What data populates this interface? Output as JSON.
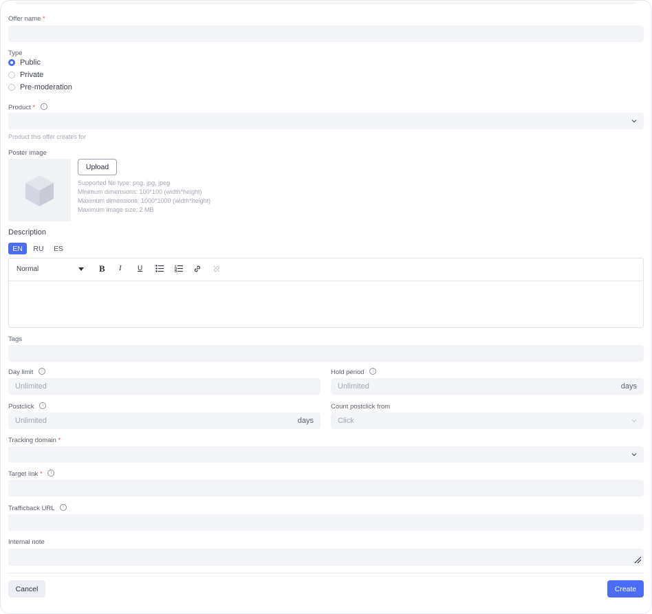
{
  "form": {
    "offer_name": {
      "label": "Offer name",
      "required_mark": "*",
      "value": ""
    },
    "type": {
      "label": "Type",
      "options": [
        {
          "label": "Public",
          "selected": true
        },
        {
          "label": "Private",
          "selected": false
        },
        {
          "label": "Pre-moderation",
          "selected": false
        }
      ]
    },
    "product": {
      "label": "Product",
      "required_mark": "*",
      "value": "",
      "hint": "Product this offer creates for"
    },
    "poster": {
      "label": "Poster image",
      "upload_label": "Upload",
      "hints": [
        "Supported file type: png, jpg, jpeg",
        "Minimum dimensions: 100*100 (width*height)",
        "Maximum dimensions: 1000*1000 (width*height)",
        "Maximum image size: 2 MB"
      ]
    },
    "description": {
      "label": "Description",
      "langs": [
        "EN",
        "RU",
        "ES"
      ],
      "active_lang": "EN",
      "format_value": "Normal",
      "toolbar": {
        "bold": "B",
        "italic": "I",
        "underline": "U"
      }
    },
    "tags": {
      "label": "Tags",
      "value": ""
    },
    "day_limit": {
      "label": "Day limit",
      "placeholder": "Unlimited"
    },
    "hold_period": {
      "label": "Hold period",
      "placeholder": "Unlimited",
      "suffix": "days"
    },
    "postclick": {
      "label": "Postclick",
      "placeholder": "Unlimited",
      "suffix": "days"
    },
    "count_postclick_from": {
      "label": "Count postclick from",
      "value": "Click"
    },
    "tracking_domain": {
      "label": "Tracking domain",
      "required_mark": "*",
      "value": ""
    },
    "target_link": {
      "label": "Target link",
      "required_mark": "*",
      "value": ""
    },
    "trafficback_url": {
      "label": "Trafficback URL",
      "value": ""
    },
    "internal_note": {
      "label": "Internal note",
      "value": ""
    }
  },
  "footer": {
    "cancel_label": "Cancel",
    "create_label": "Create"
  },
  "colors": {
    "accent": "#4a6cf7",
    "field_bg": "#f3f4f8",
    "required": "#e0564a"
  }
}
